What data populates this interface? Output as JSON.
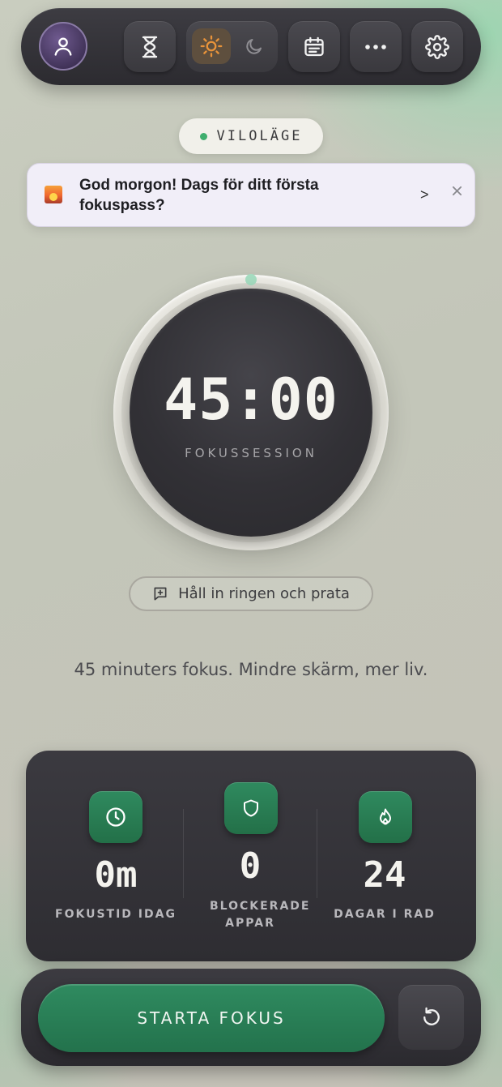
{
  "topbar": {
    "icons": [
      "user-icon",
      "hourglass-icon",
      "sun-icon",
      "moon-icon",
      "calendar-icon",
      "more-icon",
      "settings-icon"
    ]
  },
  "status": {
    "label": "VILOLÄGE",
    "dot_color": "#3fae6e"
  },
  "notification": {
    "text": "God morgon! Dags för ditt första fokuspass?",
    "arrow": ">",
    "icon": "sunrise-image"
  },
  "timer": {
    "time": "45:00",
    "label": "FOKUSSESSION"
  },
  "hold_button": {
    "label": "Håll in ringen och prata"
  },
  "tagline": "45 minuters fokus. Mindre skärm, mer liv.",
  "stats": [
    {
      "icon": "clock-icon",
      "value": "0m",
      "label": "FOKUSTID IDAG"
    },
    {
      "icon": "shield-icon",
      "value": "0",
      "label": "BLOCKERADE APPAR"
    },
    {
      "icon": "flame-icon",
      "value": "24",
      "label": "DAGAR I RAD"
    }
  ],
  "actions": {
    "start_label": "STARTA FOKUS",
    "reset_icon": "reset-icon"
  },
  "colors": {
    "accent": "#2f8b60",
    "dark": "#2e2d32",
    "sun": "#e8933a"
  }
}
